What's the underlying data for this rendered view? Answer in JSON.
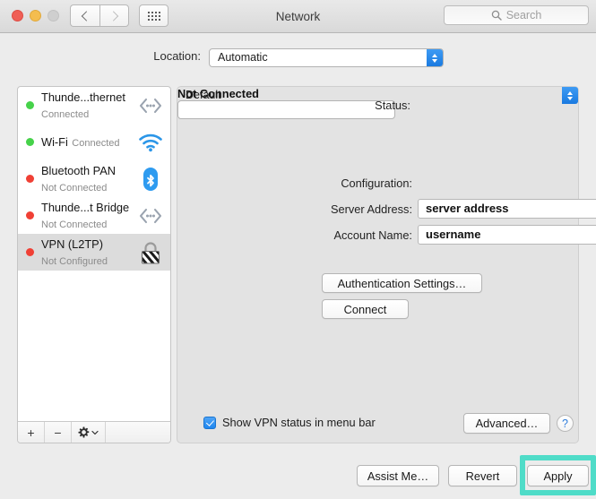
{
  "window": {
    "title": "Network",
    "traffic_lights": {
      "close": "close-button",
      "minimize": "minimize-button",
      "zoom": "zoom-button"
    },
    "colors": {
      "close": "#ef5f56",
      "minimize": "#f4bd4f",
      "zoom": "#cfcfcf",
      "highlight": "#4fdcc8",
      "accent_blue": "#1e86ef",
      "status_connected": "#46d24a",
      "status_disconnected": "#f04035"
    }
  },
  "toolbar": {
    "back_label": "‹",
    "forward_label": "›",
    "grid_label": "show-all-button",
    "search": {
      "placeholder": "Search",
      "icon": "search-icon"
    }
  },
  "location": {
    "label": "Location:",
    "value": "Automatic"
  },
  "sidebar": {
    "services": [
      {
        "name": "Thunde...thernet",
        "status": "Connected",
        "state": "connected",
        "icon": "thunderbolt-ethernet-icon"
      },
      {
        "name": "Wi-Fi",
        "status": "Connected",
        "state": "connected",
        "icon": "wifi-icon"
      },
      {
        "name": "Bluetooth PAN",
        "status": "Not Connected",
        "state": "disconnected",
        "icon": "bluetooth-icon"
      },
      {
        "name": "Thunde...t Bridge",
        "status": "Not Connected",
        "state": "disconnected",
        "icon": "thunderbolt-bridge-icon"
      },
      {
        "name": "VPN (L2TP)",
        "status": "Not Configured",
        "state": "disconnected",
        "icon": "vpn-lock-icon",
        "selected": true
      }
    ],
    "toolbar": {
      "add_label": "+",
      "remove_label": "−",
      "action_label": "gear-icon"
    }
  },
  "main": {
    "status_label": "Status:",
    "status_value": "Not Connected",
    "configuration_label": "Configuration:",
    "configuration_value": "Default",
    "server_address_label": "Server Address:",
    "server_address_value": "server address",
    "account_name_label": "Account Name:",
    "account_name_value": "username",
    "auth_settings_label": "Authentication Settings…",
    "connect_label": "Connect",
    "show_vpn_status_label": "Show VPN status in menu bar",
    "show_vpn_status_checked": true,
    "advanced_label": "Advanced…",
    "help_label": "?"
  },
  "footer": {
    "assist_label": "Assist Me…",
    "revert_label": "Revert",
    "apply_label": "Apply"
  }
}
